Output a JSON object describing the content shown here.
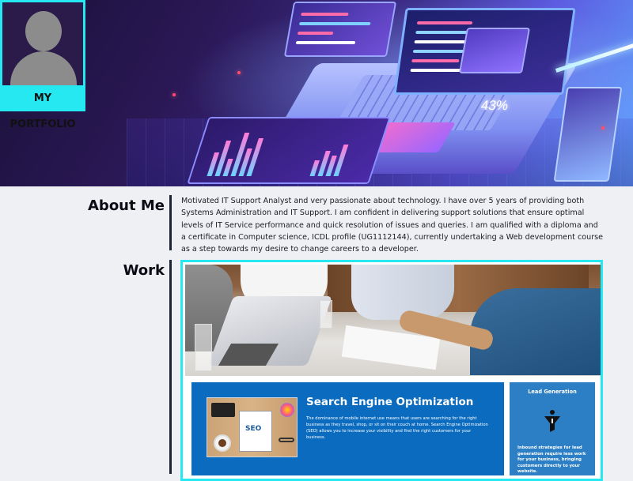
{
  "profile": {
    "label": "MY PORTFOLIO",
    "avatar_icon": "person-silhouette-icon"
  },
  "hero": {
    "gauge_text": "43%"
  },
  "about": {
    "title": "About Me",
    "text": "Motivated IT Support Analyst and very passionate about technology. I have over 5 years of providing both Systems Administration and IT Support. I am confident in delivering support solutions that ensure optimal levels of IT Service performance and quick resolution of issues and queries. I am qualified with a diploma and a certificate in Computer science, ICDL profile (UG1112144), currently undertaking a Web development course as a step towards my desire to change careers to a developer."
  },
  "work": {
    "title": "Work",
    "projects": [
      {
        "title": "Search Engine Optimization",
        "description": "The dominance of mobile internet use means that users are searching for the right business as they travel, shop, or sit on their couch at home. Search Engine Optimization (SEO) allows you to increase your visibility and find the right customers for your business.",
        "image_text": "SEO"
      },
      {
        "title": "Lead Generation",
        "description": "Inbound strategies for lead generation require less work for your business, bringing customers directly to your website.",
        "icon": "funnel-icon"
      }
    ]
  },
  "colors": {
    "accent": "#26e8f1",
    "background": "#eef0f4",
    "seo_card": "#0b6cbf",
    "lead_card": "#2c7fc4",
    "divider": "#1a2338"
  }
}
